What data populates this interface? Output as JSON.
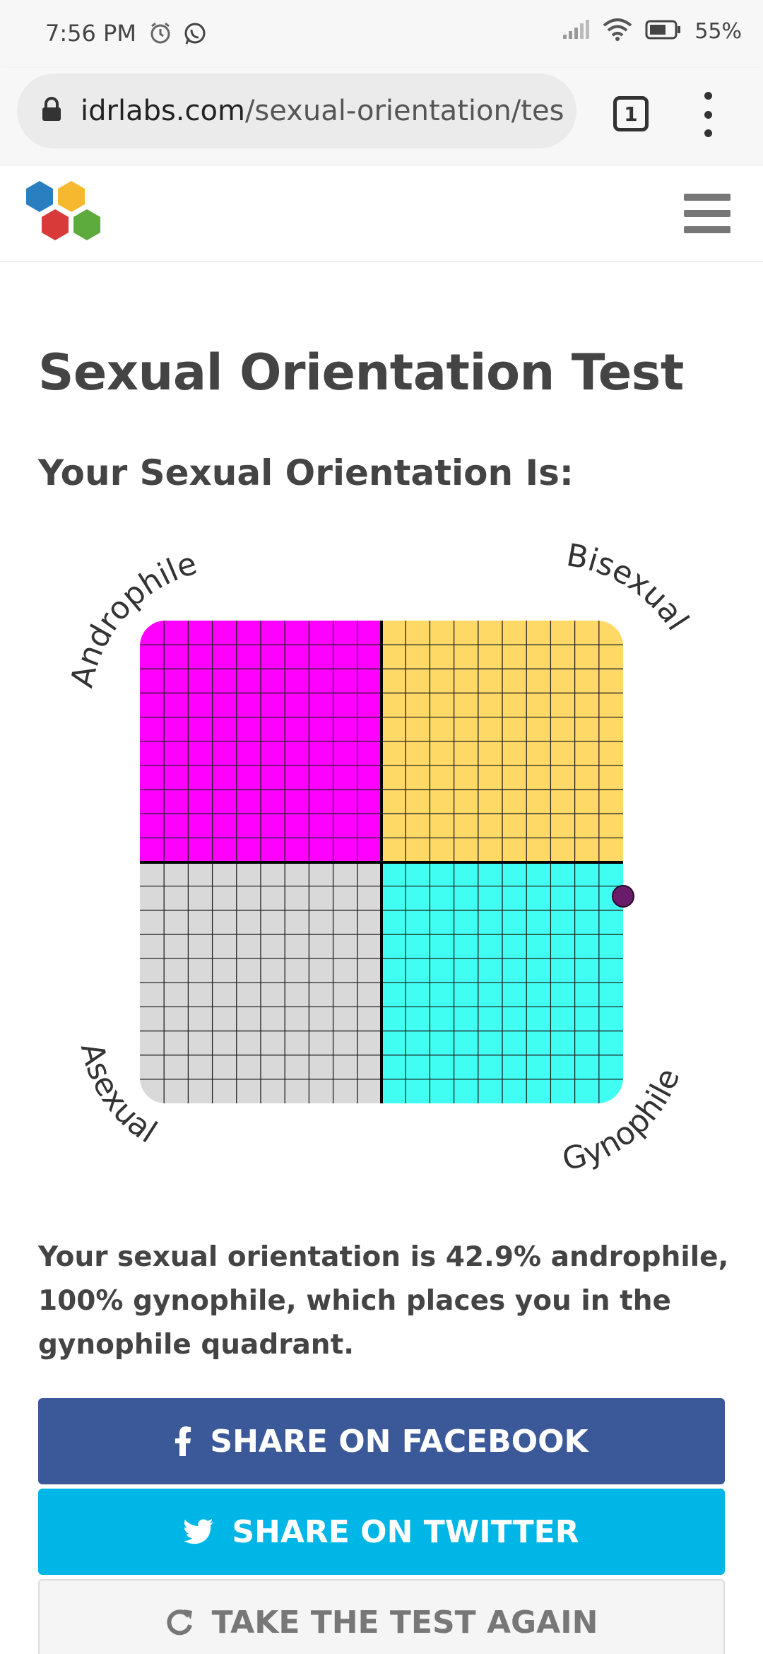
{
  "status_bar": {
    "time": "7:56 PM",
    "battery": "55%"
  },
  "browser": {
    "url_domain": "idrlabs.com",
    "url_path": "/sexual-orientation/tes",
    "tab_count": "1"
  },
  "page": {
    "title": "Sexual Orientation Test",
    "subtitle": "Your Sexual Orientation Is:",
    "result": "Your sexual orientation is 42.9% androphile, 100% gynophile, which places you in the gynophile quadrant."
  },
  "chart_data": {
    "type": "scatter",
    "corner_labels": {
      "top_left": "Androphile",
      "top_right": "Bisexual",
      "bottom_left": "Asexual",
      "bottom_right": "Gynophile"
    },
    "quadrant_colors": {
      "top_left": "#ff00ff",
      "top_right": "#ffd966",
      "bottom_left": "#d9d9d9",
      "bottom_right": "#40fff2"
    },
    "x": 100,
    "y": 42.9,
    "xlim": [
      0,
      100
    ],
    "ylim": [
      0,
      100
    ],
    "grid": true,
    "marker_color": "#6a1b6a"
  },
  "buttons": {
    "facebook": "SHARE ON FACEBOOK",
    "twitter": "SHARE ON TWITTER",
    "retake": "TAKE THE TEST AGAIN"
  }
}
